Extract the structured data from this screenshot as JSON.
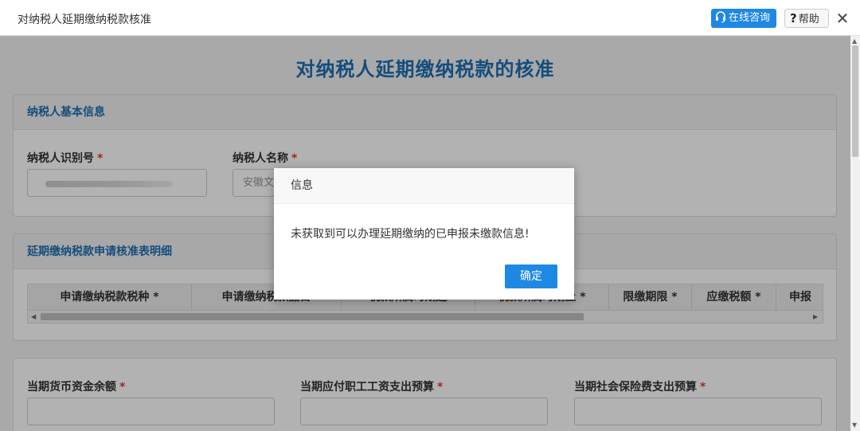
{
  "window": {
    "title": "对纳税人延期缴纳税款核准",
    "consult_label": "在线咨询",
    "help_label": "帮助",
    "close_glyph": "✕"
  },
  "page": {
    "title": "对纳税人延期缴纳税款的核准"
  },
  "basic_info": {
    "header": "纳税人基本信息",
    "taxpayer_id_label": "纳税人识别号",
    "taxpayer_name_label": "纳税人名称",
    "taxpayer_name_value": "安徽文",
    "required_mark": "*"
  },
  "detail_table": {
    "header": "延期缴纳税款申请核准表明细",
    "columns": [
      {
        "label": "申请缴纳税款税种 *"
      },
      {
        "label": "申请缴纳税款品目"
      },
      {
        "label": "税款所属时期起"
      },
      {
        "label": "税款所属时期止 *"
      },
      {
        "label": "限缴期限 *"
      },
      {
        "label": "应缴税额 *"
      },
      {
        "label": "申报"
      }
    ],
    "scroll_left": "◀",
    "scroll_right": "▶"
  },
  "budget": {
    "currency_label": "当期货币资金余额",
    "salary_label": "当期应付职工工资支出预算",
    "social_label": "当期社会保险费支出预算",
    "required_mark": "*"
  },
  "scrollbar": {
    "up": "▲",
    "down": "▼"
  },
  "dialog": {
    "title": "信息",
    "message": "未获取到可以办理延期缴纳的已申报未缴款信息!",
    "ok_label": "确定"
  },
  "colors": {
    "accent": "#1e88e5",
    "title_blue": "#1f6fb2",
    "required": "#e53935"
  }
}
